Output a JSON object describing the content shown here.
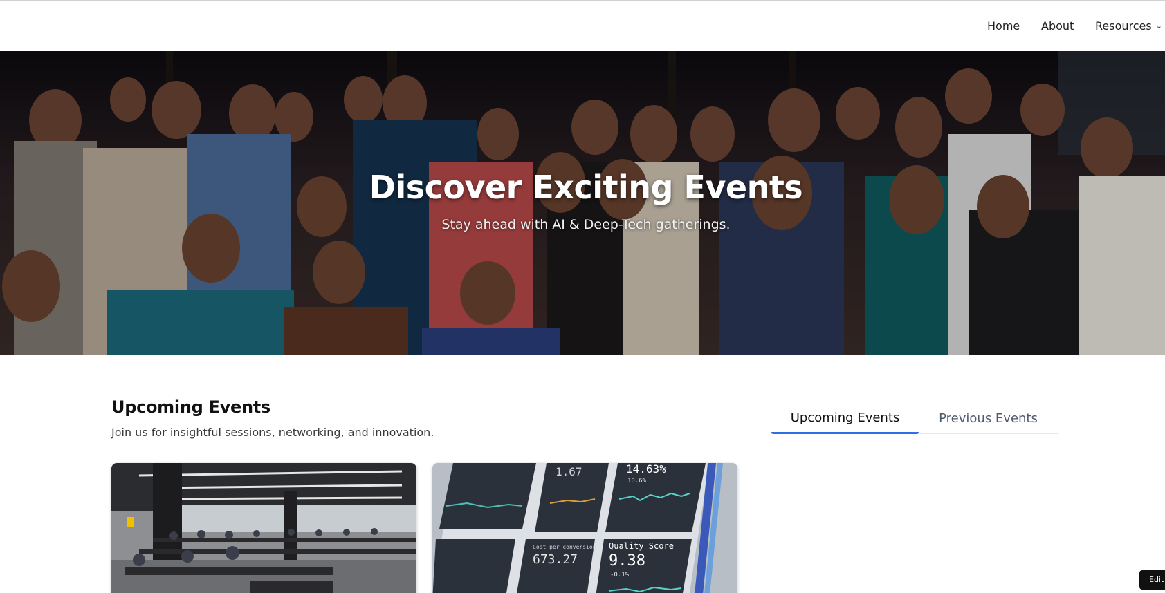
{
  "nav": {
    "items": [
      {
        "label": "Home"
      },
      {
        "label": "About"
      },
      {
        "label": "Resources"
      }
    ],
    "dropdown_icon": "chevron-down-icon"
  },
  "hero": {
    "title": "Discover Exciting Events",
    "subtitle": "Stay ahead with AI & Deep-Tech gatherings."
  },
  "events": {
    "title": "Upcoming Events",
    "description": "Join us for insightful sessions, networking, and innovation.",
    "tabs": [
      {
        "label": "Upcoming Events",
        "active": true
      },
      {
        "label": "Previous Events",
        "active": false
      }
    ],
    "tab_accent_color": "#2f6fe0",
    "cards": [
      {
        "image": "open-office-coworking-photo"
      },
      {
        "image": "analytics-dashboard-photo",
        "panels": [
          {
            "label": "Quality Score",
            "value": "9.38",
            "delta": "-0.1%"
          },
          {
            "label": "Cost per conversion",
            "value": "673.27"
          },
          {
            "label": "",
            "value": "14.63%",
            "delta": "10.6%"
          },
          {
            "label": "",
            "value": "1.67"
          }
        ]
      }
    ]
  },
  "edit_button": {
    "label": "Edit"
  }
}
